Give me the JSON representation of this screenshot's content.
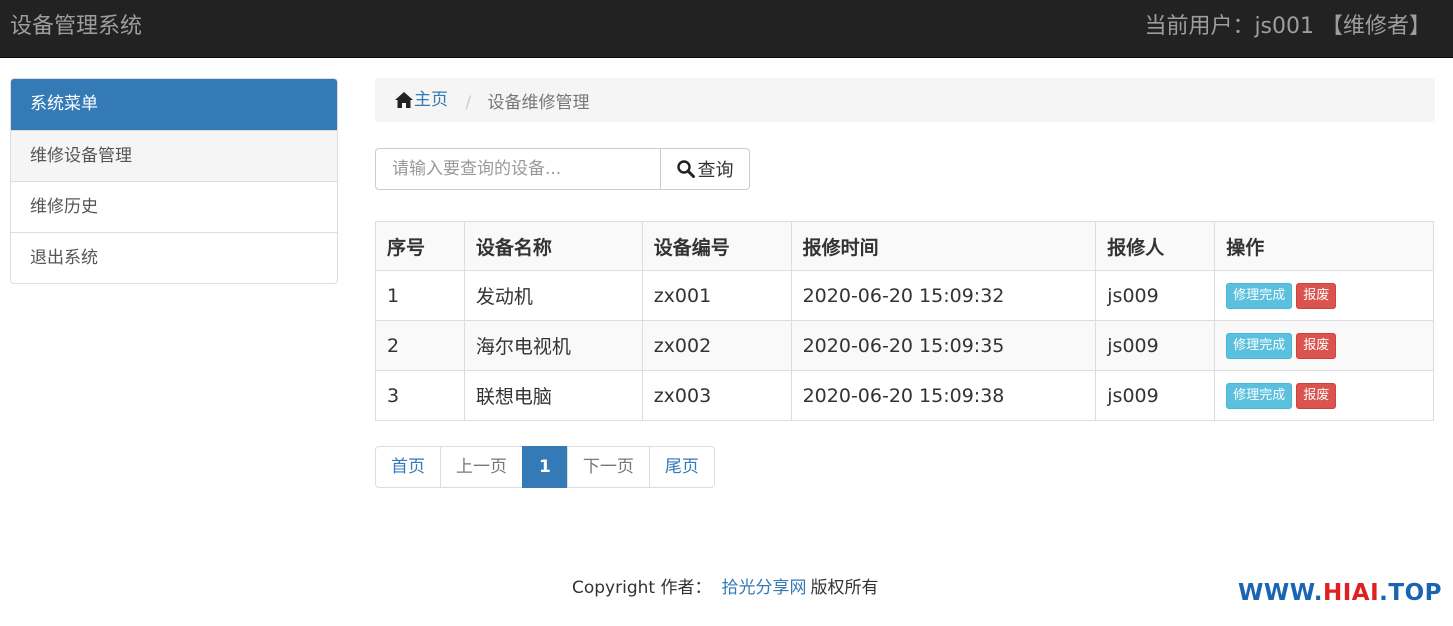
{
  "header": {
    "brand": "设备管理系统",
    "user_info": "当前用户：js001 【维修者】"
  },
  "sidebar": {
    "heading": "系统菜单",
    "items": [
      {
        "label": "维修设备管理"
      },
      {
        "label": "维修历史"
      },
      {
        "label": "退出系统"
      }
    ]
  },
  "breadcrumb": {
    "home": "主页",
    "separator": "/",
    "current": "设备维修管理"
  },
  "search": {
    "placeholder": "请输入要查询的设备...",
    "button": "查询"
  },
  "table": {
    "headers": [
      "序号",
      "设备名称",
      "设备编号",
      "报修时间",
      "报修人",
      "操作"
    ],
    "rows": [
      {
        "no": "1",
        "name": "发动机",
        "code": "zx001",
        "time": "2020-06-20 15:09:32",
        "reporter": "js009"
      },
      {
        "no": "2",
        "name": "海尔电视机",
        "code": "zx002",
        "time": "2020-06-20 15:09:35",
        "reporter": "js009"
      },
      {
        "no": "3",
        "name": "联想电脑",
        "code": "zx003",
        "time": "2020-06-20 15:09:38",
        "reporter": "js009"
      }
    ],
    "action_complete": "修理完成",
    "action_scrap": "报废"
  },
  "pagination": {
    "first": "首页",
    "prev": "上一页",
    "current": "1",
    "next": "下一页",
    "last": "尾页"
  },
  "footer": {
    "prefix": "Copyright 作者：",
    "link": "拾光分享网",
    "suffix": "版权所有"
  },
  "watermark": {
    "part1": "WWW.",
    "part2": "HIAI",
    "part3": ".TOP"
  },
  "colors": {
    "navbar": "#222222",
    "primary": "#337ab7",
    "info": "#5bc0de",
    "danger": "#d9534f"
  }
}
